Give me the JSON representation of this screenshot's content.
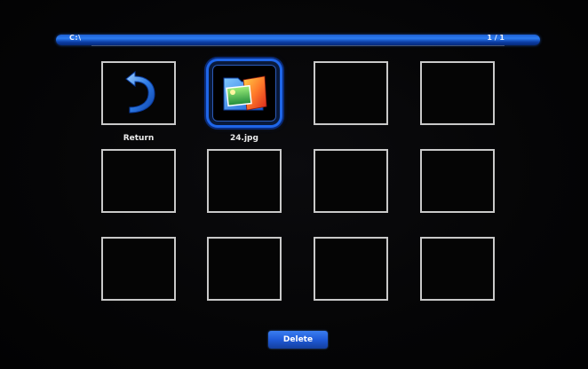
{
  "header": {
    "path": "C:\\",
    "page_indicator": "1 / 1"
  },
  "items": [
    {
      "label": "Return",
      "icon": "return-arrow-icon"
    },
    {
      "label": "24.jpg",
      "icon": "photo-folder-icon",
      "selected": true
    }
  ],
  "footer": {
    "delete_label": "Delete"
  },
  "colors": {
    "accent": "#1f66e8",
    "cell_border": "#c9c9c9",
    "background": "#000000"
  }
}
